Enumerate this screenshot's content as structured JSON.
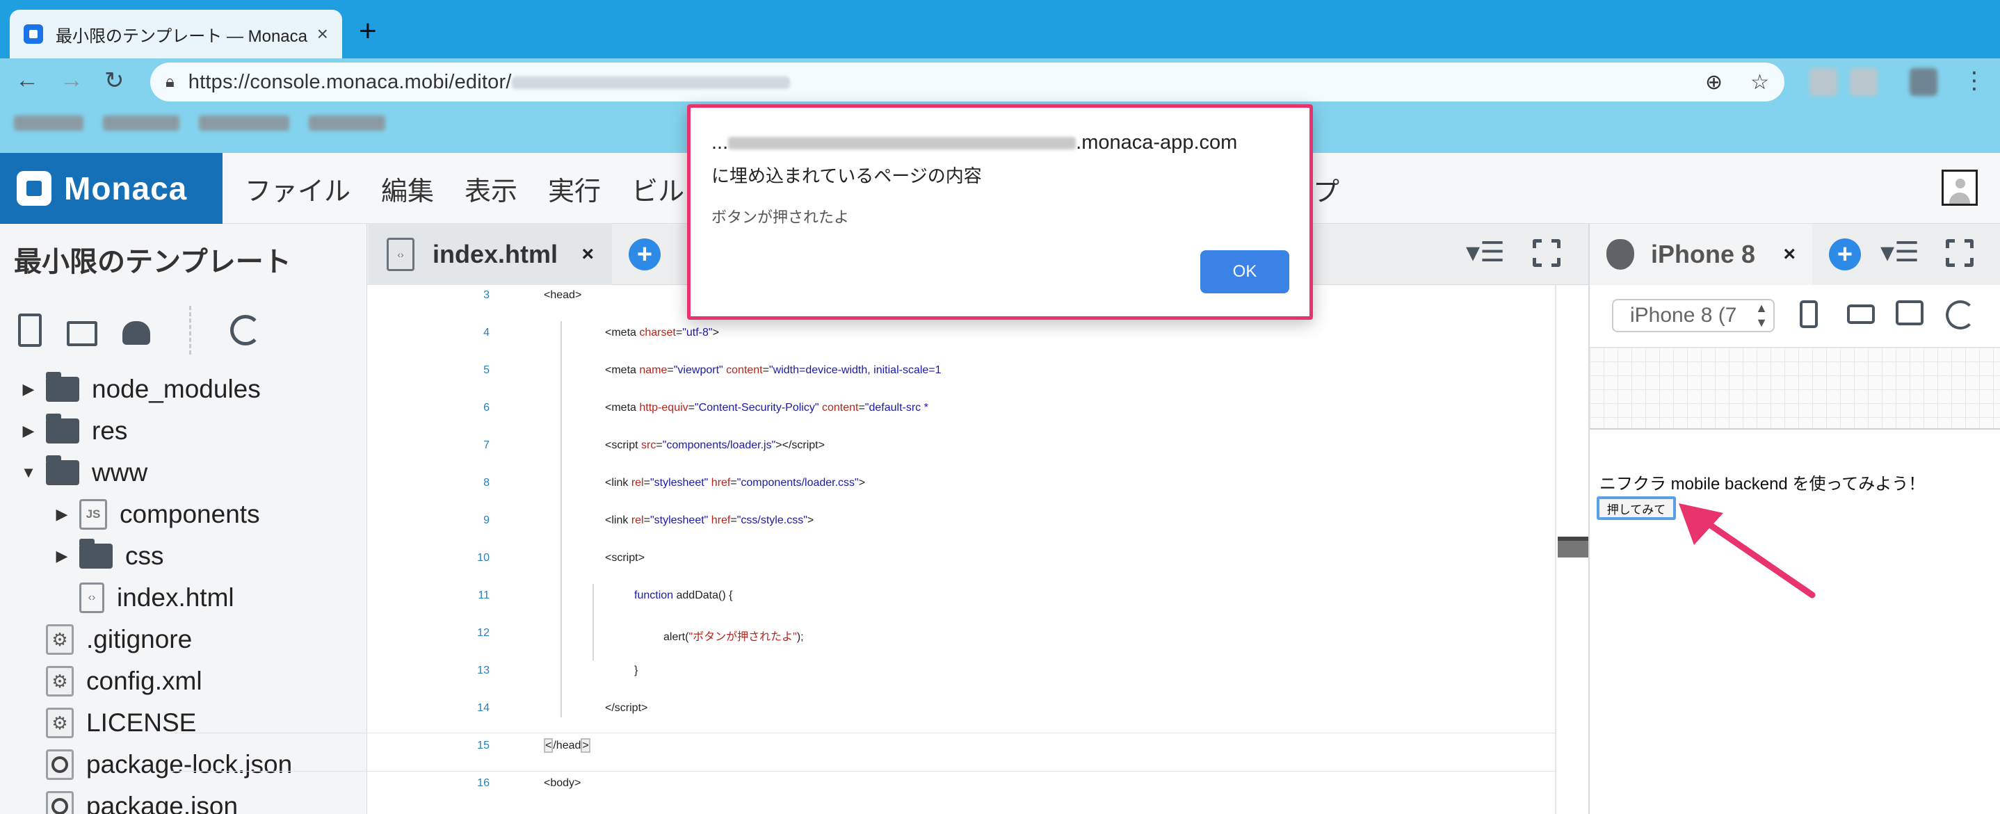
{
  "browser": {
    "tab_title": "最小限のテンプレート — Monaca",
    "tab_close": "×",
    "new_tab": "+",
    "url_visible": "https://console.monaca.mobi/editor/"
  },
  "monaca": {
    "logo": "Monaca",
    "menu": [
      "ファイル",
      "編集",
      "表示",
      "実行",
      "ビル"
    ],
    "menu_help": "ルプ"
  },
  "sidebar": {
    "project_title": "最小限のテンプレート",
    "tree": [
      {
        "label": "node_modules",
        "type": "folder",
        "expanded": false,
        "indent": 0
      },
      {
        "label": "res",
        "type": "folder",
        "expanded": false,
        "indent": 0
      },
      {
        "label": "www",
        "type": "folder",
        "expanded": true,
        "indent": 0
      },
      {
        "label": "components",
        "type": "js-folder",
        "expanded": false,
        "indent": 1
      },
      {
        "label": "css",
        "type": "folder",
        "expanded": false,
        "indent": 1
      },
      {
        "label": "index.html",
        "type": "html",
        "indent": 1
      },
      {
        "label": ".gitignore",
        "type": "config",
        "indent": 0
      },
      {
        "label": "config.xml",
        "type": "config",
        "indent": 0
      },
      {
        "label": "LICENSE",
        "type": "config",
        "indent": 0
      },
      {
        "label": "package-lock.json",
        "type": "json",
        "indent": 0
      },
      {
        "label": "package.json",
        "type": "json",
        "indent": 0
      }
    ]
  },
  "editor": {
    "tab_label": "index.html",
    "tab_close": "×",
    "line_numbers": [
      "3",
      "4",
      "5",
      "6",
      "7",
      "8",
      "9",
      "10",
      "11",
      "12",
      "13",
      "14",
      "15",
      "16"
    ]
  },
  "preview": {
    "tab_label": "iPhone 8",
    "tab_close": "×",
    "device_select": "iPhone 8 (7",
    "phone_text": "ニフクラ mobile backend を使ってみよう！",
    "phone_button": "押してみて"
  },
  "alert": {
    "origin_prefix": "...",
    "origin_suffix": ".monaca-app.com",
    "subtitle": "に埋め込まれているページの内容",
    "message": "ボタンが押されたよ",
    "ok_label": "OK"
  },
  "colors": {
    "tabstrip": "#1f9fe0",
    "toolbar": "#84d3ee",
    "monaca_blue": "#1570b8",
    "alert_border": "#e8336d",
    "ok_button": "#3b82e6",
    "arrow": "#e8336d"
  },
  "icons": [
    "favicon-icon",
    "back-icon",
    "forward-icon",
    "reload-icon",
    "lock-icon",
    "zoom-icon",
    "star-icon",
    "menu-dots-icon",
    "new-file-icon",
    "new-folder-icon",
    "upload-icon",
    "refresh-icon",
    "plus-icon",
    "hamburger-icon",
    "fullscreen-icon",
    "apple-icon",
    "phone-portrait-icon",
    "phone-landscape-icon",
    "tablet-icon",
    "rotate-icon",
    "user-icon"
  ]
}
